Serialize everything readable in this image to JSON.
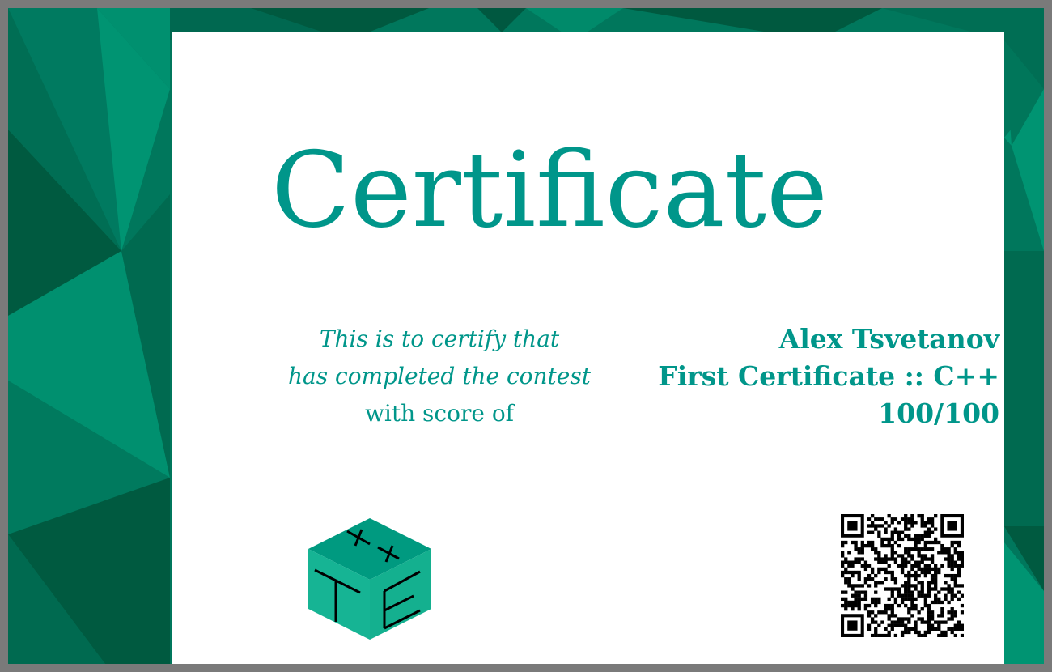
{
  "certificate": {
    "title": "Certificate",
    "intro_line1": "This is to certify that",
    "intro_line2": "has completed the contest",
    "intro_line3": "with score of",
    "recipient_name": "Alex Tsvetanov",
    "contest_name": "First Certificate :: C++",
    "score": "100/100"
  },
  "logo": {
    "icon": "cube-logo-icon",
    "face_letters": [
      "T",
      "E"
    ],
    "top_symbols": "++"
  },
  "qr": {
    "icon": "qr-code-icon"
  },
  "colors": {
    "accent": "#00968a",
    "background_green": "#007a5e",
    "paper": "#ffffff"
  }
}
